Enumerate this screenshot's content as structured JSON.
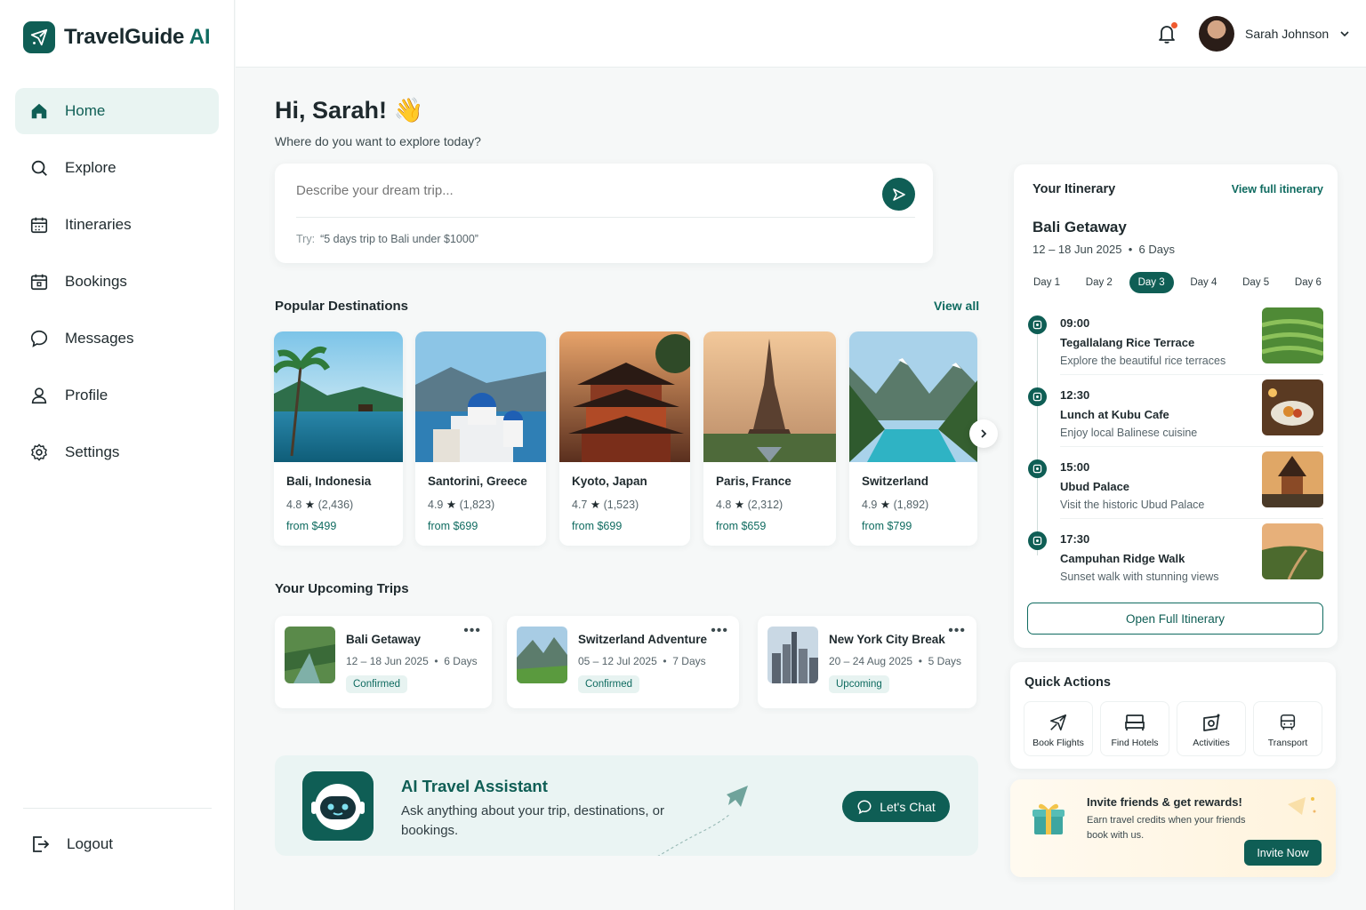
{
  "brand": {
    "name": "TravelGuide",
    "suffix": "AI"
  },
  "sidebar": {
    "items": [
      {
        "label": "Home",
        "icon": "home-icon",
        "active": true
      },
      {
        "label": "Explore",
        "icon": "search-icon",
        "active": false
      },
      {
        "label": "Itineraries",
        "icon": "calendar-icon",
        "active": false
      },
      {
        "label": "Bookings",
        "icon": "calendar-check-icon",
        "active": false
      },
      {
        "label": "Messages",
        "icon": "chat-icon",
        "active": false
      },
      {
        "label": "Profile",
        "icon": "user-icon",
        "active": false
      },
      {
        "label": "Settings",
        "icon": "gear-icon",
        "active": false
      }
    ],
    "logout": "Logout"
  },
  "header": {
    "user_name": "Sarah Johnson",
    "notification_icon": "bell-icon"
  },
  "hero": {
    "greeting": "Hi, Sarah!",
    "emoji": "👋",
    "subtitle": "Where do you want to explore today?",
    "search_placeholder": "Describe your dream trip...",
    "try_label": "Try:",
    "try_example": "“5 days trip to Bali under $1000”"
  },
  "popular": {
    "title": "Popular Destinations",
    "view_all": "View all",
    "items": [
      {
        "name": "Bali, Indonesia",
        "rating": "4.8",
        "reviews": "(2,436)",
        "price": "from $499"
      },
      {
        "name": "Santorini, Greece",
        "rating": "4.9",
        "reviews": "(1,823)",
        "price": "from $699"
      },
      {
        "name": "Kyoto, Japan",
        "rating": "4.7",
        "reviews": "(1,523)",
        "price": "from $699"
      },
      {
        "name": "Paris, France",
        "rating": "4.8",
        "reviews": "(2,312)",
        "price": "from $659"
      },
      {
        "name": "Switzerland",
        "rating": "4.9",
        "reviews": "(1,892)",
        "price": "from $799"
      }
    ]
  },
  "upcoming": {
    "title": "Your Upcoming Trips",
    "items": [
      {
        "title": "Bali Getaway",
        "dates": "12 – 18 Jun 2025",
        "duration": "6 Days",
        "status": "Confirmed"
      },
      {
        "title": "Switzerland Adventure",
        "dates": "05 – 12 Jul 2025",
        "duration": "7 Days",
        "status": "Confirmed"
      },
      {
        "title": "New York City Break",
        "dates": "20 – 24 Aug 2025",
        "duration": "5 Days",
        "status": "Upcoming"
      }
    ]
  },
  "assistant": {
    "title": "AI Travel Assistant",
    "description": "Ask anything about your trip, destinations, or bookings.",
    "button": "Let's Chat"
  },
  "itinerary": {
    "title": "Your Itinerary",
    "view_full": "View full itinerary",
    "trip_name": "Bali Getaway",
    "dates": "12 – 18 Jun 2025",
    "duration": "6 Days",
    "days": [
      "Day 1",
      "Day 2",
      "Day 3",
      "Day 4",
      "Day 5",
      "Day 6"
    ],
    "active_day": "Day 3",
    "events": [
      {
        "time": "09:00",
        "name": "Tegallalang Rice Terrace",
        "desc": "Explore the beautiful rice terraces"
      },
      {
        "time": "12:30",
        "name": "Lunch at Kubu Cafe",
        "desc": "Enjoy local Balinese cuisine"
      },
      {
        "time": "15:00",
        "name": "Ubud Palace",
        "desc": "Visit the historic Ubud Palace"
      },
      {
        "time": "17:30",
        "name": "Campuhan Ridge Walk",
        "desc": "Sunset walk with stunning views"
      }
    ],
    "open_button": "Open Full Itinerary"
  },
  "quick_actions": {
    "title": "Quick Actions",
    "items": [
      {
        "label": "Book Flights",
        "icon": "plane-icon"
      },
      {
        "label": "Find Hotels",
        "icon": "bed-icon"
      },
      {
        "label": "Activities",
        "icon": "activities-icon"
      },
      {
        "label": "Transport",
        "icon": "bus-icon"
      }
    ]
  },
  "invite": {
    "title": "Invite friends & get rewards!",
    "desc": "Earn travel credits when your friends book with us.",
    "button": "Invite Now"
  }
}
